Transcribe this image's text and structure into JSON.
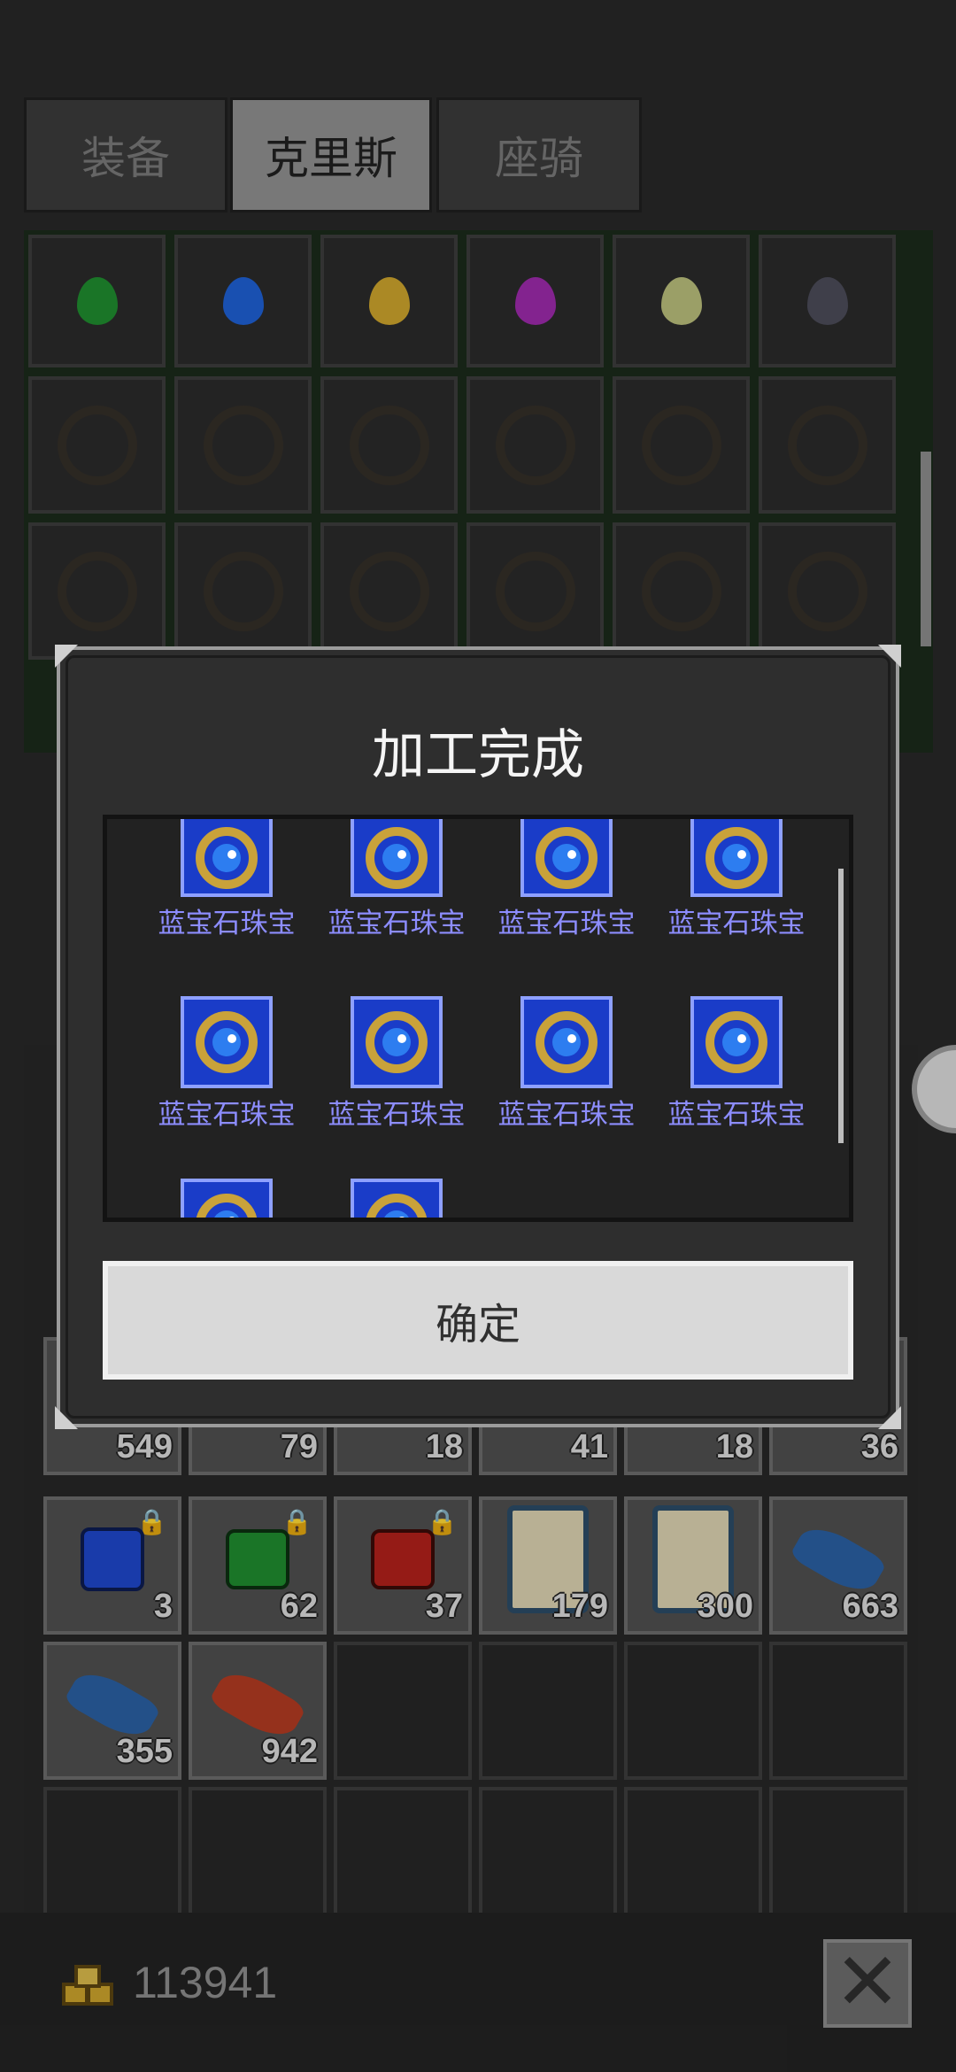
{
  "tabs": [
    {
      "label": "装备",
      "active": false
    },
    {
      "label": "克里斯",
      "active": true
    },
    {
      "label": "座骑",
      "active": false
    }
  ],
  "top_gems": [
    {
      "color": "#1f8a2e"
    },
    {
      "color": "#1e5fd0"
    },
    {
      "color": "#c9a22c"
    },
    {
      "color": "#9a2aa8"
    },
    {
      "color": "#b7bb7a"
    },
    {
      "color": "#4a4a58"
    }
  ],
  "dialog": {
    "title": "加工完成",
    "reward_label": "蓝宝石珠宝",
    "rewards": [
      {
        "label": "蓝宝石珠宝"
      },
      {
        "label": "蓝宝石珠宝"
      },
      {
        "label": "蓝宝石珠宝"
      },
      {
        "label": "蓝宝石珠宝"
      },
      {
        "label": "蓝宝石珠宝"
      },
      {
        "label": "蓝宝石珠宝"
      },
      {
        "label": "蓝宝石珠宝"
      },
      {
        "label": "蓝宝石珠宝"
      },
      {
        "label": ""
      },
      {
        "label": ""
      }
    ],
    "confirm_label": "确定"
  },
  "inventory": {
    "row1": [
      {
        "count": "549"
      },
      {
        "count": "79"
      },
      {
        "count": "18"
      },
      {
        "count": "41"
      },
      {
        "count": "18"
      },
      {
        "count": "36"
      }
    ],
    "row2": [
      {
        "count": "3",
        "item": "blue-gem",
        "locked": true
      },
      {
        "count": "62",
        "item": "green-gem",
        "locked": true
      },
      {
        "count": "37",
        "item": "red-gem",
        "locked": true
      },
      {
        "count": "179",
        "item": "scroll"
      },
      {
        "count": "300",
        "item": "scroll"
      },
      {
        "count": "663",
        "item": "blue-feather"
      }
    ],
    "row3": [
      {
        "count": "355",
        "item": "blue-feather"
      },
      {
        "count": "942",
        "item": "red-feather"
      }
    ]
  },
  "footer": {
    "gold": "113941",
    "close_icon": "close-icon"
  }
}
